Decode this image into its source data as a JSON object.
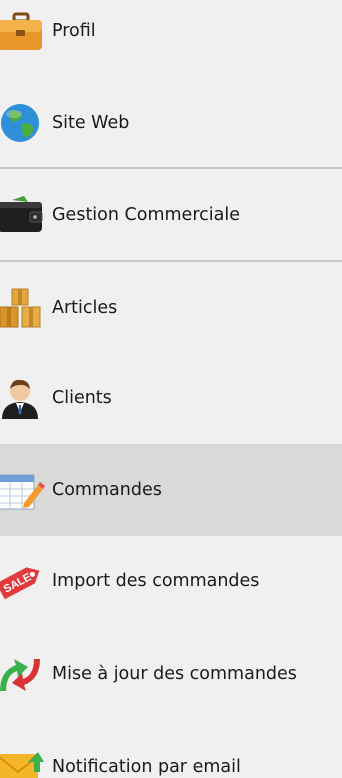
{
  "menu": {
    "items": [
      {
        "label": "Profil",
        "icon": "briefcase-icon"
      },
      {
        "label": "Site Web",
        "icon": "globe-icon"
      },
      {
        "label": "Gestion Commerciale",
        "icon": "wallet-icon"
      },
      {
        "label": "Articles",
        "icon": "boxes-icon"
      },
      {
        "label": "Clients",
        "icon": "client-person-icon"
      },
      {
        "label": "Commandes",
        "icon": "order-form-icon",
        "selected": true
      },
      {
        "label": "Import des commandes",
        "icon": "sale-tag-icon"
      },
      {
        "label": "Mise à jour des commandes",
        "icon": "update-arrows-icon"
      },
      {
        "label": "Notification par email",
        "icon": "email-icon"
      }
    ]
  },
  "icon_text": {
    "sale_tag": "SALE"
  },
  "colors": {
    "background": "#f0f0f0",
    "selected_background": "#d9d9d9",
    "divider": "#c9c9c9",
    "text": "#1a1a1a"
  }
}
